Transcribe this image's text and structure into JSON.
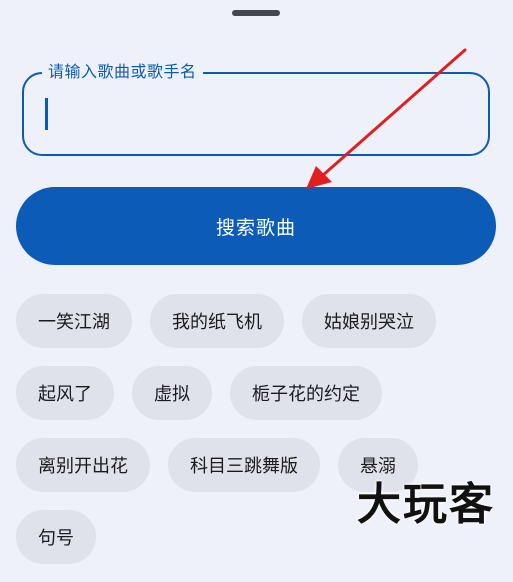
{
  "search": {
    "label": "请输入歌曲或歌手名",
    "value": "",
    "placeholder": ""
  },
  "search_button": {
    "label": "搜索歌曲"
  },
  "suggestions": {
    "row1": [
      "一笑江湖",
      "我的纸飞机",
      "姑娘别哭泣"
    ],
    "row2": [
      "起风了",
      "虚拟",
      "栀子花的约定"
    ],
    "row3": [
      "离别开出花",
      "科目三跳舞版",
      "悬溺"
    ],
    "row4": [
      "句号"
    ]
  },
  "watermark": {
    "text": "大玩客"
  },
  "colors": {
    "accent": "#0b5bb7",
    "background": "#eef1fa",
    "chip": "#dfe2eb",
    "annotation_arrow": "#e02020"
  },
  "icons": {
    "annotation": "red-arrow-icon",
    "handle": "drag-handle"
  }
}
